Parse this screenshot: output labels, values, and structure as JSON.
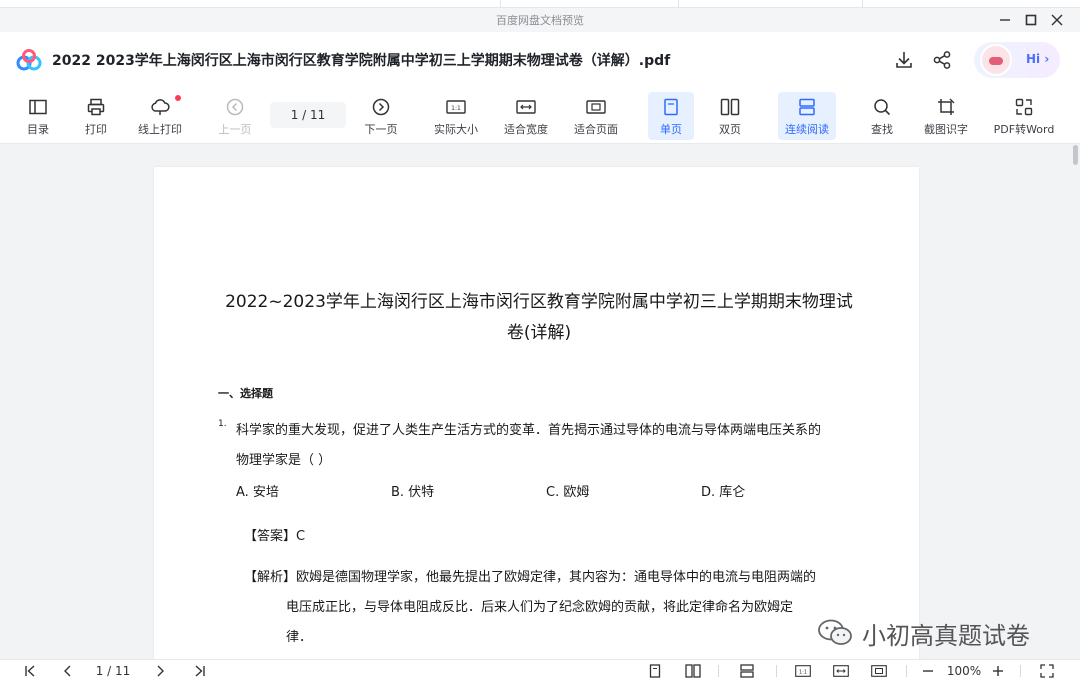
{
  "window": {
    "title": "百度网盘文档预览",
    "controls": [
      "minimize-icon",
      "maximize-icon",
      "close-icon"
    ]
  },
  "header": {
    "doc_title": "2022  2023学年上海闵行区上海市闵行区教育学院附属中学初三上学期期末物理试卷（详解）.pdf",
    "assistant_label": "Hi ›"
  },
  "toolbar": {
    "items": [
      {
        "label": "目录",
        "icon": "toc-icon"
      },
      {
        "label": "打印",
        "icon": "printer-icon"
      },
      {
        "label": "线上打印",
        "icon": "cloud-print-icon"
      },
      {
        "label": "上一页",
        "icon": "prev-page-icon"
      },
      {
        "label": "下一页",
        "icon": "next-page-icon"
      },
      {
        "label": "实际大小",
        "icon": "actual-size-icon"
      },
      {
        "label": "适合宽度",
        "icon": "fit-width-icon"
      },
      {
        "label": "适合页面",
        "icon": "fit-page-icon"
      },
      {
        "label": "单页",
        "icon": "single-page-icon"
      },
      {
        "label": "双页",
        "icon": "double-page-icon"
      },
      {
        "label": "连续阅读",
        "icon": "continuous-icon"
      },
      {
        "label": "查找",
        "icon": "search-icon"
      },
      {
        "label": "截图识字",
        "icon": "crop-ocr-icon"
      },
      {
        "label": "PDF转Word",
        "icon": "convert-icon"
      }
    ],
    "page_indicator": "1  / 11"
  },
  "document": {
    "title_line1": "2022~2023学年上海闵行区上海市闵行区教育学院附属中学初三上学期期末物理试",
    "title_line2": "卷(详解)",
    "section": "一、选择题",
    "q1_number": "1.",
    "q1_line1": "科学家的重大发现，促进了人类生产生活方式的变革．首先揭示通过导体的电流与导体两端电压关系的",
    "q1_line2": "物理学家是（    ）",
    "options": [
      "A. 安培",
      "B. 伏特",
      "C. 欧姆",
      "D. 库仑"
    ],
    "answer": "【答案】C",
    "explanation_line1": "【解析】欧姆是德国物理学家，他最先提出了欧姆定律，其内容为：通电导体中的电流与电阻两端的",
    "explanation_line2": "电压成正比，与导体电阻成反比．后来人们为了纪念欧姆的贡献，将此定律命名为欧姆定",
    "explanation_line3": "律．"
  },
  "watermark": "小初高真题试卷",
  "statusbar": {
    "page_indicator": "1 / 11",
    "zoom": "100%"
  },
  "colors": {
    "accent": "#2f6bff",
    "active_bg": "#e6f0ff",
    "badge": "#ff3b55"
  }
}
